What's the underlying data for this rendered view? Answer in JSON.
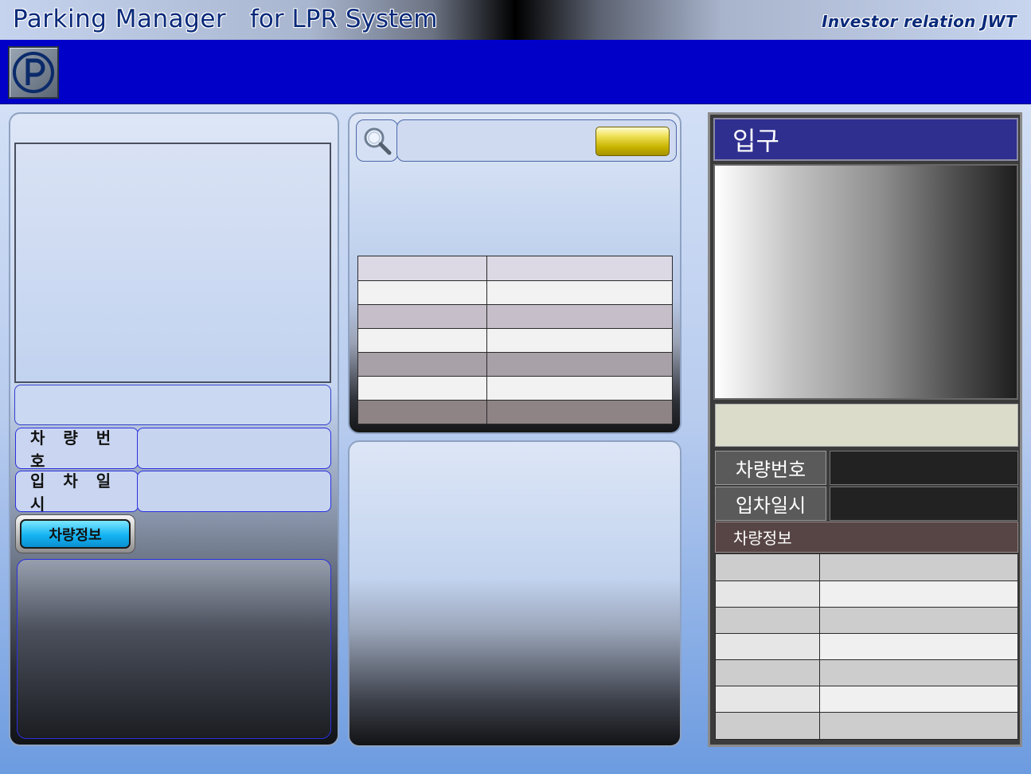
{
  "header": {
    "title": "Parking Manager",
    "subtitle": "for LPR System",
    "brand": "Investor relation JWT"
  },
  "left": {
    "plate_label": "차 량 번 호",
    "entry_time_label": "입 차 일 시",
    "car_info_button": "차량정보"
  },
  "search": {
    "query": ""
  },
  "results_table": {
    "row_colors": [
      "#dcd8e4",
      "#f2f2f2",
      "#c6bfca",
      "#f2f2f2",
      "#a9a1a8",
      "#f2f2f2",
      "#8e8486"
    ]
  },
  "right": {
    "entry_title": "입구",
    "plate_label": "차량번호",
    "entry_time_label": "입차일시",
    "car_info_label": "차량정보",
    "info_rows": 7
  },
  "colors": {
    "header_bar": "#0000c8",
    "entry_title_bg": "#2f2f8f",
    "accent_button": "#14b3f2",
    "search_button": "#e0cf2a"
  }
}
